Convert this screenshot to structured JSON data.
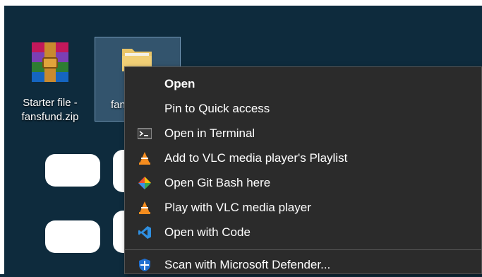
{
  "desktop": {
    "icons": [
      {
        "label_line1": "Starter file -",
        "label_line2": "fansfund.zip",
        "icon": "winrar-archive-icon"
      },
      {
        "label": "fan",
        "icon": "folder-icon"
      }
    ]
  },
  "context_menu": {
    "items": [
      {
        "label": "Open",
        "icon": "",
        "bold": true
      },
      {
        "label": "Pin to Quick access",
        "icon": ""
      },
      {
        "label": "Open in Terminal",
        "icon": "terminal-icon"
      },
      {
        "label": "Add to VLC media player's Playlist",
        "icon": "vlc-icon"
      },
      {
        "label": "Open Git Bash here",
        "icon": "git-bash-icon"
      },
      {
        "label": "Play with VLC media player",
        "icon": "vlc-icon"
      },
      {
        "label": "Open with Code",
        "icon": "vscode-icon"
      },
      {
        "label": "Scan with Microsoft Defender...",
        "icon": "defender-shield-icon"
      }
    ]
  },
  "colors": {
    "desktop_bg": "#0e2b3d",
    "menu_bg": "#2b2b2b",
    "vlc_orange": "#f58c1e",
    "vscode_blue": "#2f8fe0",
    "defender_blue": "#1f6fd1"
  }
}
